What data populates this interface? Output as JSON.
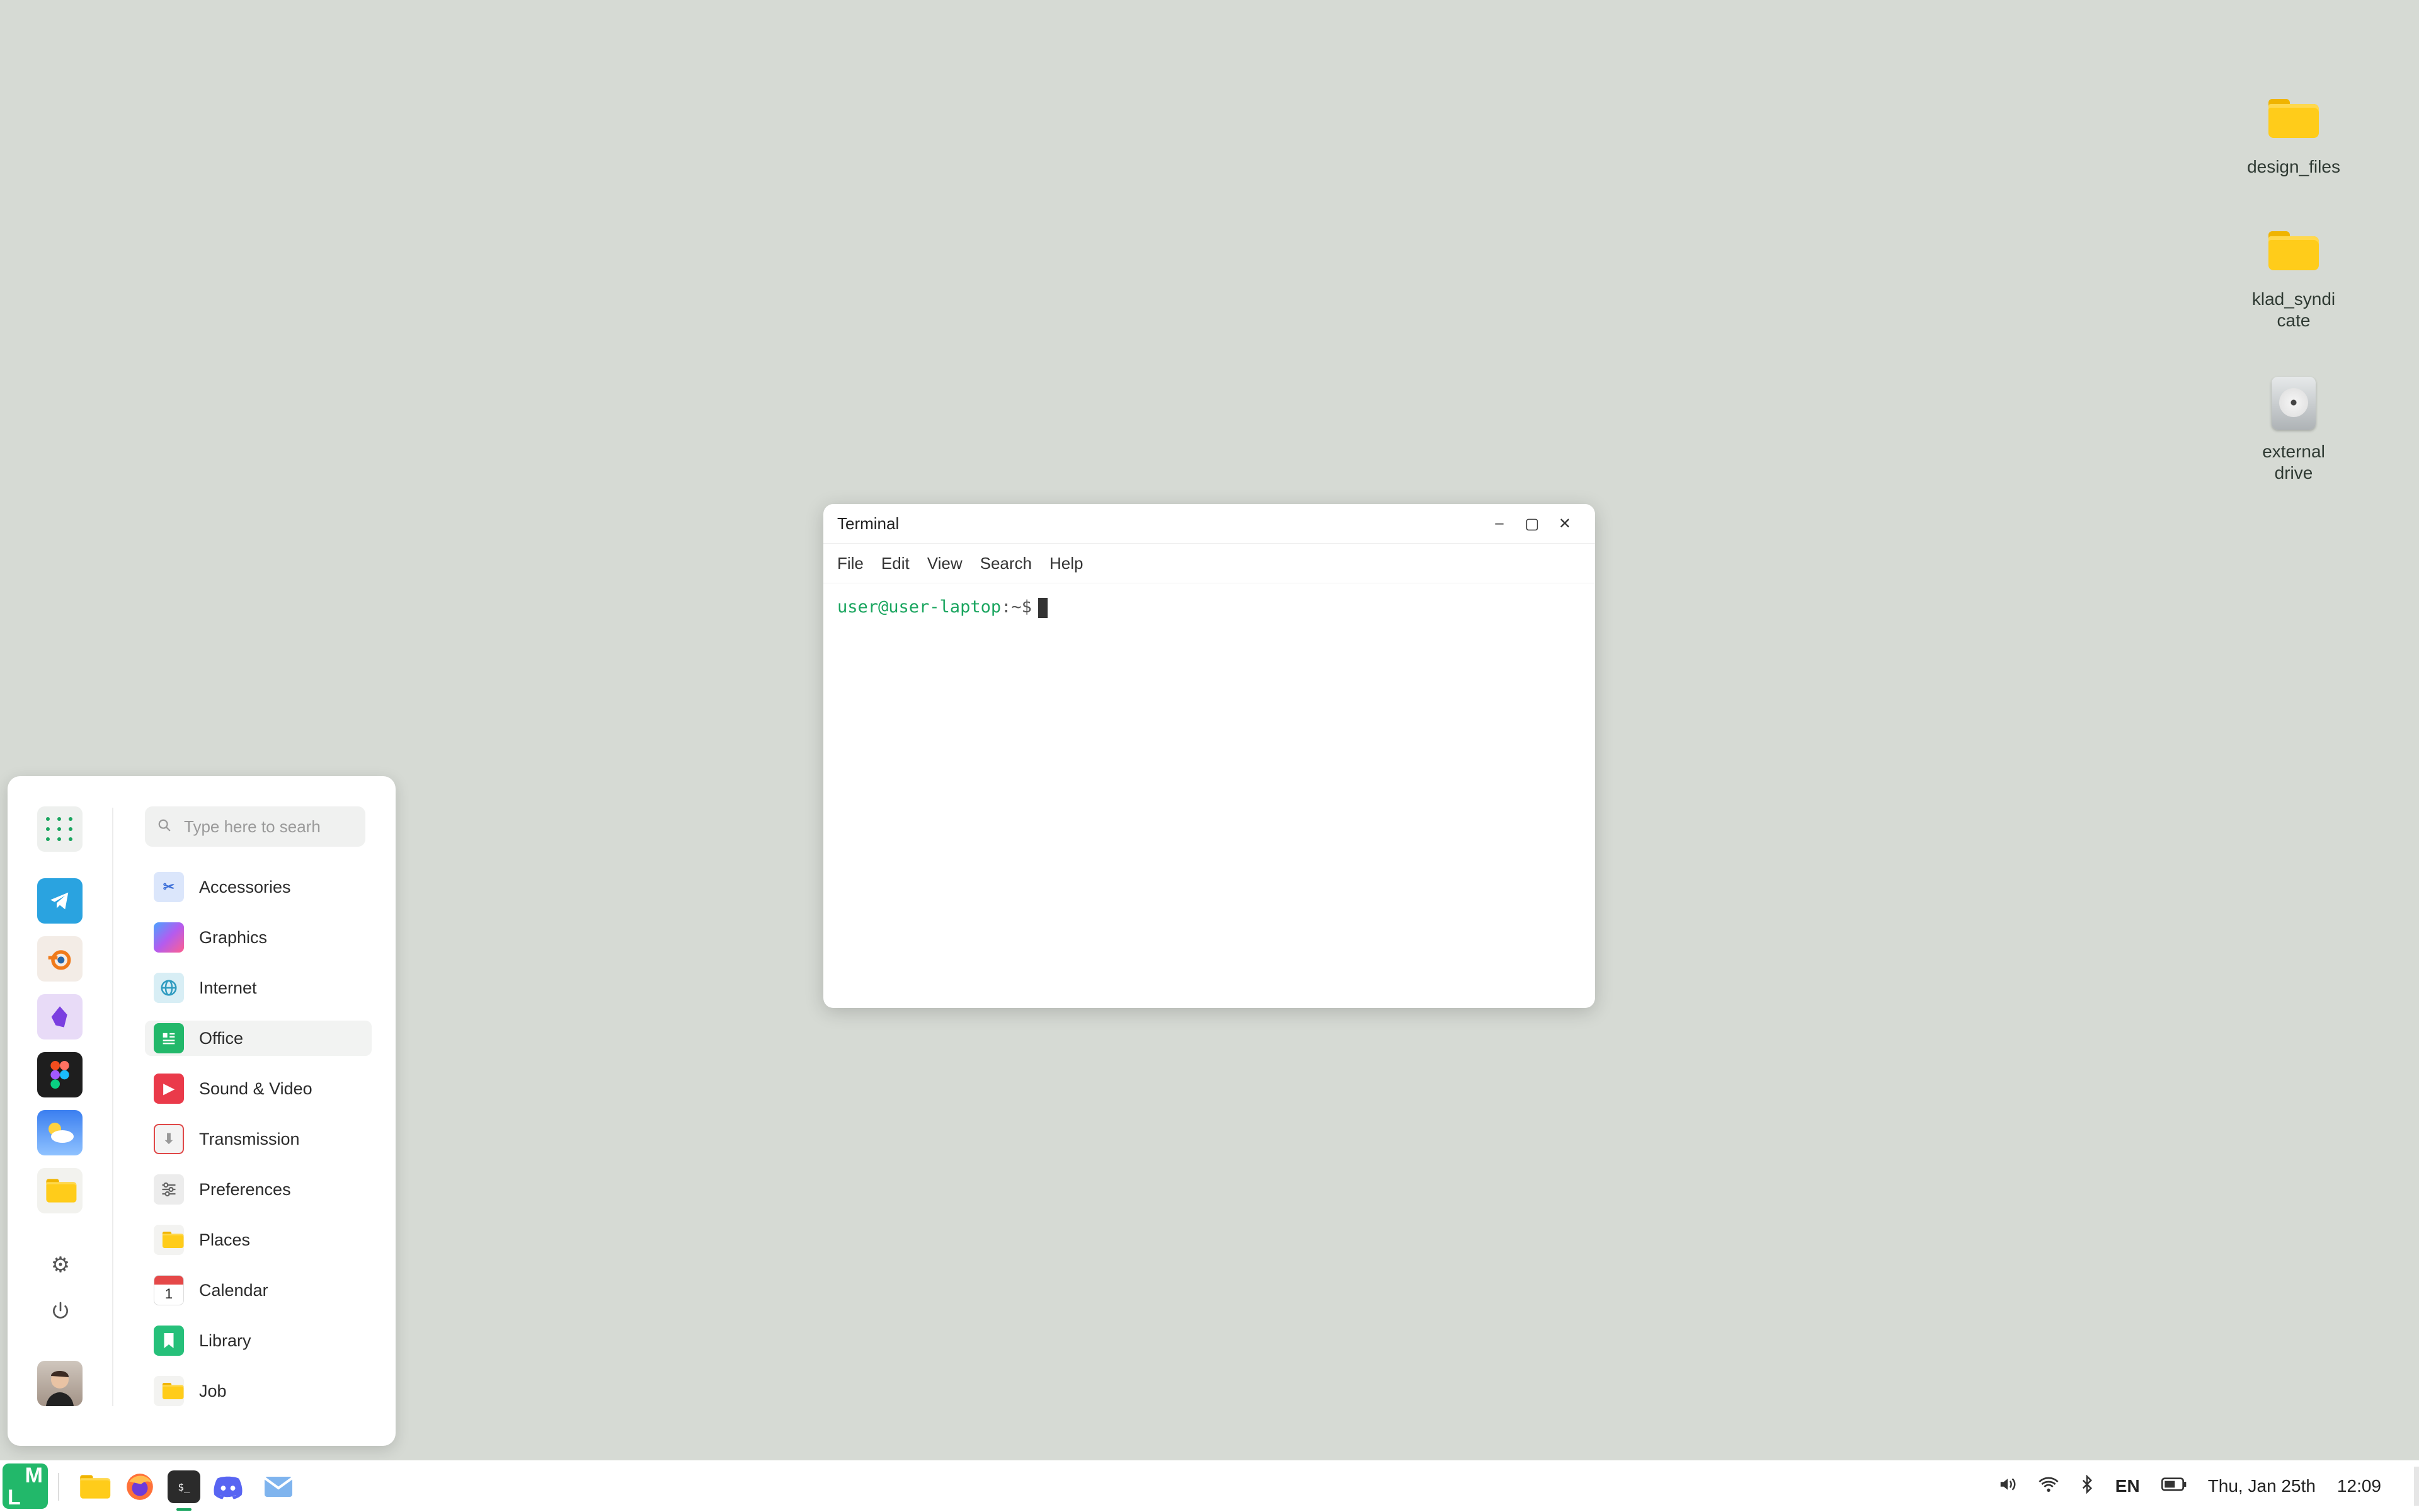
{
  "desktop": {
    "icons": [
      {
        "label": "design_files",
        "icon": "folder-icon"
      },
      {
        "label": "klad_syndicate",
        "icon": "folder-icon"
      },
      {
        "label": "external drive",
        "icon": "drive-icon"
      }
    ]
  },
  "terminal": {
    "title": "Terminal",
    "menu": [
      "File",
      "Edit",
      "View",
      "Search",
      "Help"
    ],
    "prompt_user": "user@user-laptop",
    "prompt_path": ":~$"
  },
  "startmenu": {
    "search_placeholder": "Type here to searh",
    "categories": [
      {
        "label": "Accessories",
        "color": "#5b8def"
      },
      {
        "label": "Graphics",
        "color": "#a35cf0"
      },
      {
        "label": "Internet",
        "color": "#3aa9c9"
      },
      {
        "label": "Office",
        "color": "#22b86a"
      },
      {
        "label": "Sound & Video",
        "color": "#ea3a4a"
      },
      {
        "label": "Transmission",
        "color": "#e04848"
      },
      {
        "label": "Preferences",
        "color": "#8a8f94"
      },
      {
        "label": "Places",
        "color": "#f4c21a"
      },
      {
        "label": "Calendar",
        "color": "#e54848"
      },
      {
        "label": "Library",
        "color": "#26c07a"
      },
      {
        "label": "Job",
        "color": "#f4c21a"
      }
    ],
    "active_category": "Office",
    "calendar_day": "1"
  },
  "taskbar": {
    "logo_text_top": "M",
    "logo_text_bottom": "L",
    "language": "EN",
    "date": "Thu, Jan 25th",
    "time": "12:09"
  }
}
